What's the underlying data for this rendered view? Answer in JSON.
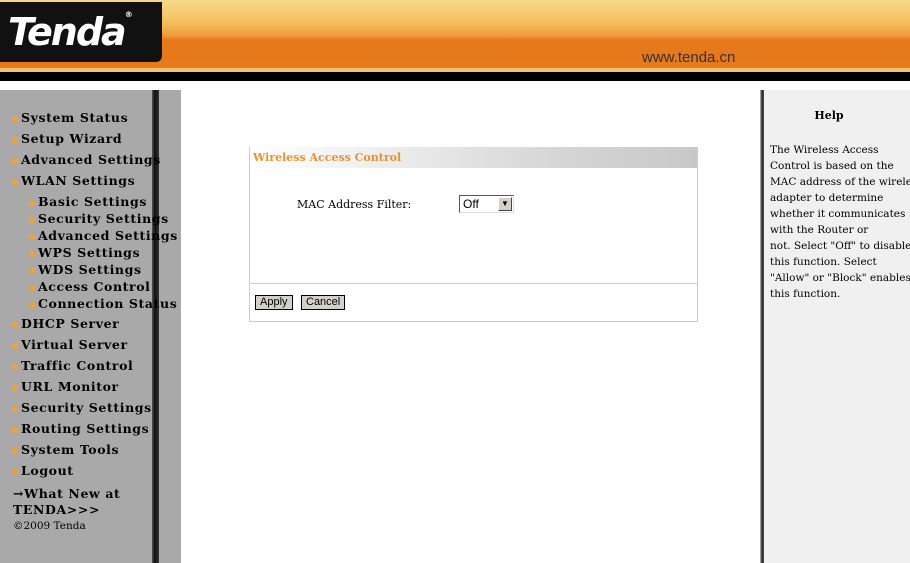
{
  "header": {
    "logo": "Tenda",
    "url": "www.tenda.cn",
    "accent": "#e87a1c"
  },
  "sidebar": {
    "items": [
      "System Status",
      "Setup Wizard",
      "Advanced Settings",
      "WLAN Settings"
    ],
    "sub_items": [
      "Basic Settings",
      "Security Settings",
      "Advanced Settings",
      "WPS Settings",
      "WDS Settings",
      "Access Control",
      "Connection Status"
    ],
    "items_after": [
      "DHCP Server",
      "Virtual Server",
      "Traffic Control",
      "URL Monitor",
      "Security Settings",
      "Routing Settings",
      "System Tools",
      "Logout"
    ],
    "whatnew_1": "→What New at",
    "whatnew_2": "TENDA>>>",
    "copyright": "©2009 Tenda"
  },
  "main": {
    "title": "Wireless Access Control",
    "mac_label": "MAC Address Filter:",
    "mac_value": "Off",
    "apply": "Apply",
    "cancel": "Cancel"
  },
  "help": {
    "title": "Help",
    "lines": [
      "The Wireless Access",
      "Control is based on the",
      "MAC address of the wireless",
      "adapter to determine",
      "whether it communicates",
      "with the Router or",
      "not. Select \"Off\" to disable",
      "this function. Select",
      "\"Allow\" or \"Block\" enables",
      "this function."
    ]
  }
}
